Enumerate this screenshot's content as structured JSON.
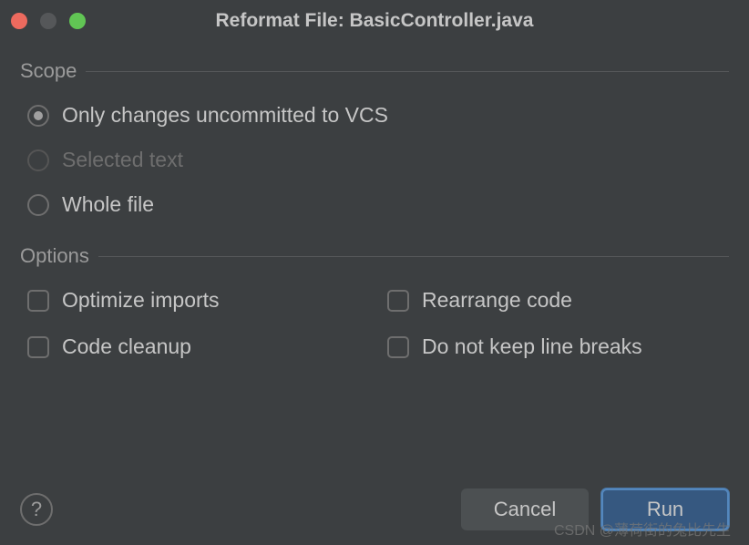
{
  "window": {
    "title": "Reformat File: BasicController.java"
  },
  "scope": {
    "title": "Scope",
    "options": [
      {
        "label": "Only changes uncommitted to VCS",
        "selected": true,
        "disabled": false
      },
      {
        "label": "Selected text",
        "selected": false,
        "disabled": true
      },
      {
        "label": "Whole file",
        "selected": false,
        "disabled": false
      }
    ]
  },
  "options": {
    "title": "Options",
    "items": [
      {
        "label": "Optimize imports",
        "checked": false
      },
      {
        "label": "Rearrange code",
        "checked": false
      },
      {
        "label": "Code cleanup",
        "checked": false
      },
      {
        "label": "Do not keep line breaks",
        "checked": false
      }
    ]
  },
  "footer": {
    "help": "?",
    "cancel": "Cancel",
    "run": "Run"
  },
  "watermark": "CSDN @薄荷街的兔比先生"
}
